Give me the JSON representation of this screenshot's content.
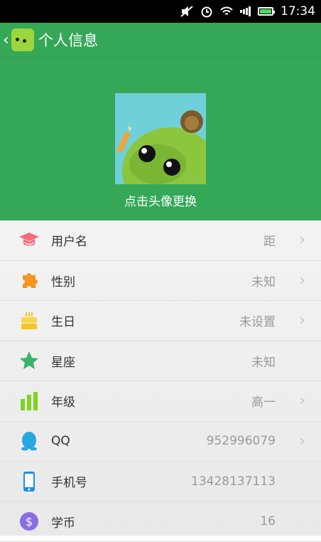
{
  "status_bar": {
    "time": "17:34",
    "icons": [
      "mute-icon",
      "alarm-icon",
      "wifi-icon",
      "signal-icon",
      "battery-icon"
    ]
  },
  "app_bar": {
    "title": "个人信息",
    "back_icon": "chevron-left-icon"
  },
  "header": {
    "avatar_hint": "点击头像更换",
    "background_color": "#35a857"
  },
  "profile_items": [
    {
      "label": "用户名",
      "value": "距",
      "icon": "graduation-cap-icon",
      "chevron": true
    },
    {
      "label": "性别",
      "value": "未知",
      "icon": "puzzle-icon",
      "chevron": true
    },
    {
      "label": "生日",
      "value": "未设置",
      "icon": "cake-icon",
      "chevron": true
    },
    {
      "label": "星座",
      "value": "未知",
      "icon": "star-icon",
      "chevron": false
    },
    {
      "label": "年级",
      "value": "高一",
      "icon": "bar-chart-icon",
      "chevron": true
    },
    {
      "label": "QQ",
      "value": "952996079",
      "icon": "qq-penguin-icon",
      "chevron": true
    },
    {
      "label": "手机号",
      "value": "13428137113",
      "icon": "phone-icon",
      "chevron": false
    },
    {
      "label": "学币",
      "value": "16",
      "icon": "coin-icon",
      "chevron": false
    }
  ],
  "chevron_glyph": "›"
}
